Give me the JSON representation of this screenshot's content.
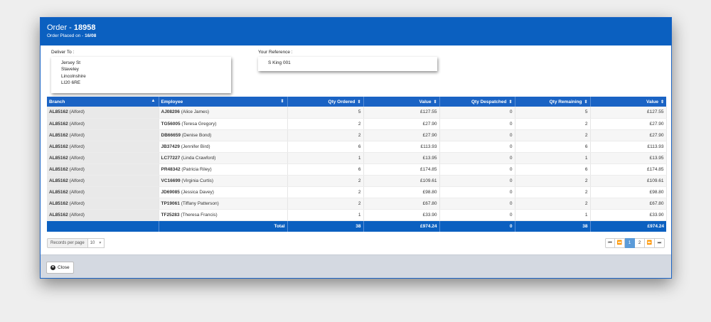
{
  "header": {
    "order_prefix": "Order - ",
    "order_number": "18958",
    "placed_prefix": "Order Placed on - ",
    "placed_date": "16/08"
  },
  "deliver": {
    "label": "Deliver To :",
    "lines": [
      "Jersey St",
      "Staveley",
      "Lincolnshire",
      "LI20 6RE"
    ]
  },
  "reference": {
    "label": "Your Reference :",
    "value": "S King 001"
  },
  "table": {
    "columns": [
      "Branch",
      "Employee",
      "Qty Ordered",
      "Value",
      "Qty Despatched",
      "Qty Remaining",
      "Value"
    ],
    "rows": [
      {
        "branch_code": "AL85162",
        "branch_name": " (Alford)",
        "emp_code": "AJ08206",
        "emp_name": " (Alice James)",
        "qty_ordered": "5",
        "value": "£127.55",
        "qty_despatched": "0",
        "qty_remaining": "5",
        "value2": "£127.55"
      },
      {
        "branch_code": "AL85162",
        "branch_name": " (Alford)",
        "emp_code": "TG56005",
        "emp_name": " (Teresa Gregory)",
        "qty_ordered": "2",
        "value": "£27.90",
        "qty_despatched": "0",
        "qty_remaining": "2",
        "value2": "£27.90"
      },
      {
        "branch_code": "AL85162",
        "branch_name": " (Alford)",
        "emp_code": "DB66659",
        "emp_name": " (Denise Bond)",
        "qty_ordered": "2",
        "value": "£27.90",
        "qty_despatched": "0",
        "qty_remaining": "2",
        "value2": "£27.90"
      },
      {
        "branch_code": "AL85162",
        "branch_name": " (Alford)",
        "emp_code": "JB37429",
        "emp_name": " (Jennifer Bird)",
        "qty_ordered": "6",
        "value": "£113.93",
        "qty_despatched": "0",
        "qty_remaining": "6",
        "value2": "£113.93"
      },
      {
        "branch_code": "AL85162",
        "branch_name": " (Alford)",
        "emp_code": "LC77227",
        "emp_name": " (Linda Crawford)",
        "qty_ordered": "1",
        "value": "£13.95",
        "qty_despatched": "0",
        "qty_remaining": "1",
        "value2": "£13.95"
      },
      {
        "branch_code": "AL85162",
        "branch_name": " (Alford)",
        "emp_code": "PR48342",
        "emp_name": " (Patricia Riley)",
        "qty_ordered": "6",
        "value": "£174.85",
        "qty_despatched": "0",
        "qty_remaining": "6",
        "value2": "£174.85"
      },
      {
        "branch_code": "AL85162",
        "branch_name": " (Alford)",
        "emp_code": "VC16699",
        "emp_name": " (Virginia Curtis)",
        "qty_ordered": "2",
        "value": "£109.61",
        "qty_despatched": "0",
        "qty_remaining": "2",
        "value2": "£109.61"
      },
      {
        "branch_code": "AL85162",
        "branch_name": " (Alford)",
        "emp_code": "JD69085",
        "emp_name": " (Jessica Davey)",
        "qty_ordered": "2",
        "value": "£98.80",
        "qty_despatched": "0",
        "qty_remaining": "2",
        "value2": "£98.80"
      },
      {
        "branch_code": "AL85162",
        "branch_name": " (Alford)",
        "emp_code": "TP19061",
        "emp_name": " (Tiffany Patterson)",
        "qty_ordered": "2",
        "value": "£67.80",
        "qty_despatched": "0",
        "qty_remaining": "2",
        "value2": "£67.80"
      },
      {
        "branch_code": "AL85162",
        "branch_name": " (Alford)",
        "emp_code": "TF25283",
        "emp_name": " (Theresa Francis)",
        "qty_ordered": "1",
        "value": "£33.90",
        "qty_despatched": "0",
        "qty_remaining": "1",
        "value2": "£33.90"
      }
    ],
    "totals": {
      "label": "Total",
      "qty_ordered": "38",
      "value": "£974.24",
      "qty_despatched": "0",
      "qty_remaining": "38",
      "value2": "£974.24"
    }
  },
  "pagination": {
    "records_label": "Records per page",
    "records_value": "10",
    "pages": [
      "1",
      "2"
    ],
    "current_page": "1",
    "first_icon": "first-page-icon",
    "prev_icon": "prev-page-icon",
    "next_icon": "next-page-icon",
    "last_icon": "last-page-icon"
  },
  "footer": {
    "close_label": "Close",
    "close_icon": "close-circle-icon"
  },
  "colors": {
    "header_blue": "#0b60c0",
    "table_header_blue": "#1a63c4",
    "active_page": "#5b9bd9"
  }
}
